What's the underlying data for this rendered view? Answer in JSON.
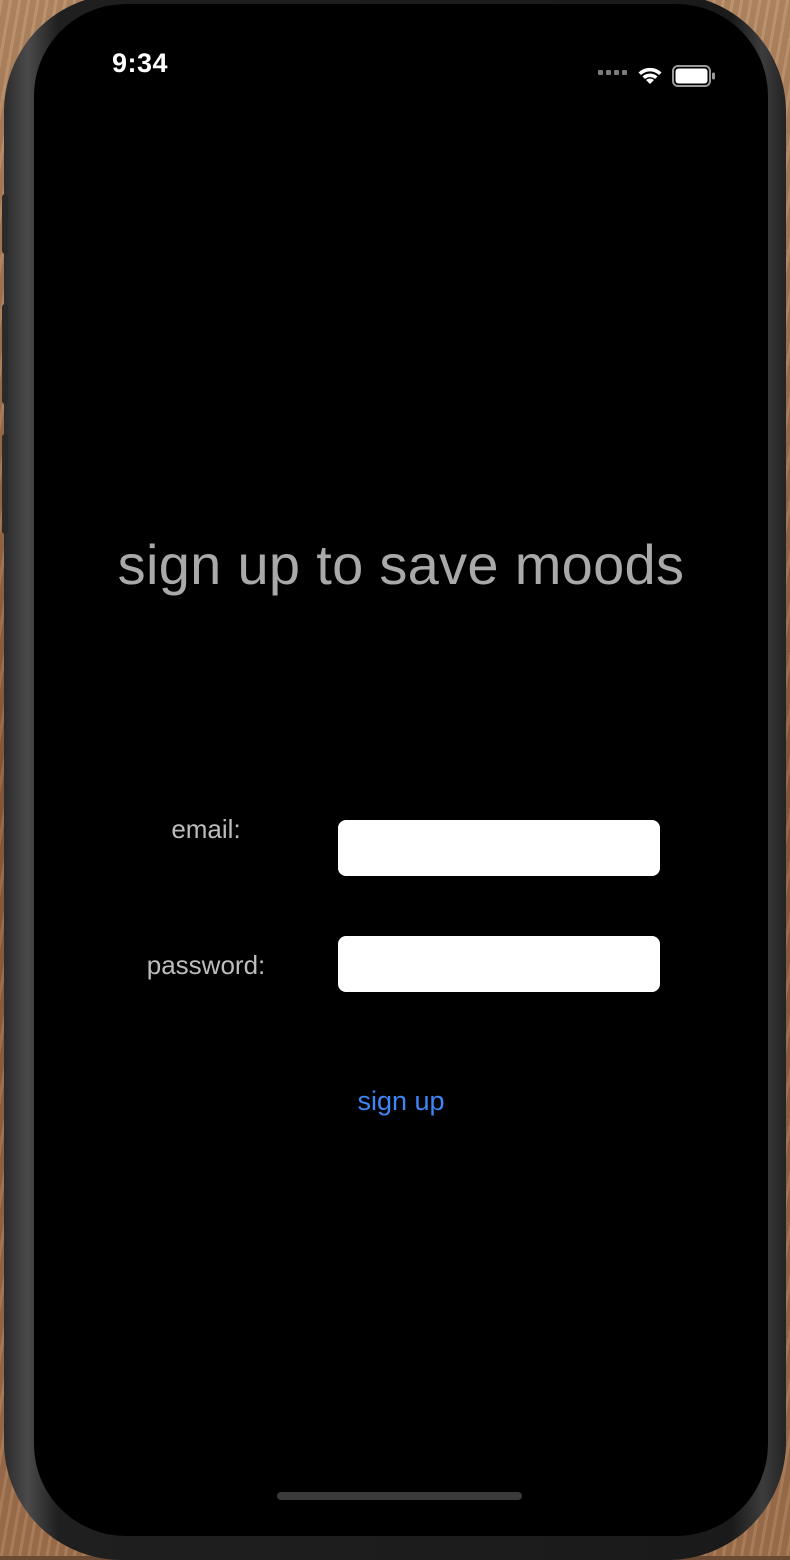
{
  "status_bar": {
    "time": "9:34",
    "icons": [
      "cellular-signal-icon",
      "wifi-icon",
      "battery-icon"
    ]
  },
  "screen": {
    "headline": "sign up to save moods",
    "form": {
      "email_label": "email:",
      "email_value": "",
      "password_label": "password:",
      "password_value": "",
      "submit_label": "sign up"
    }
  },
  "colors": {
    "background": "#000000",
    "headline": "#a9a9a9",
    "label": "#bdbdbd",
    "field_background": "#ffffff",
    "accent_link": "#3e86f5"
  }
}
